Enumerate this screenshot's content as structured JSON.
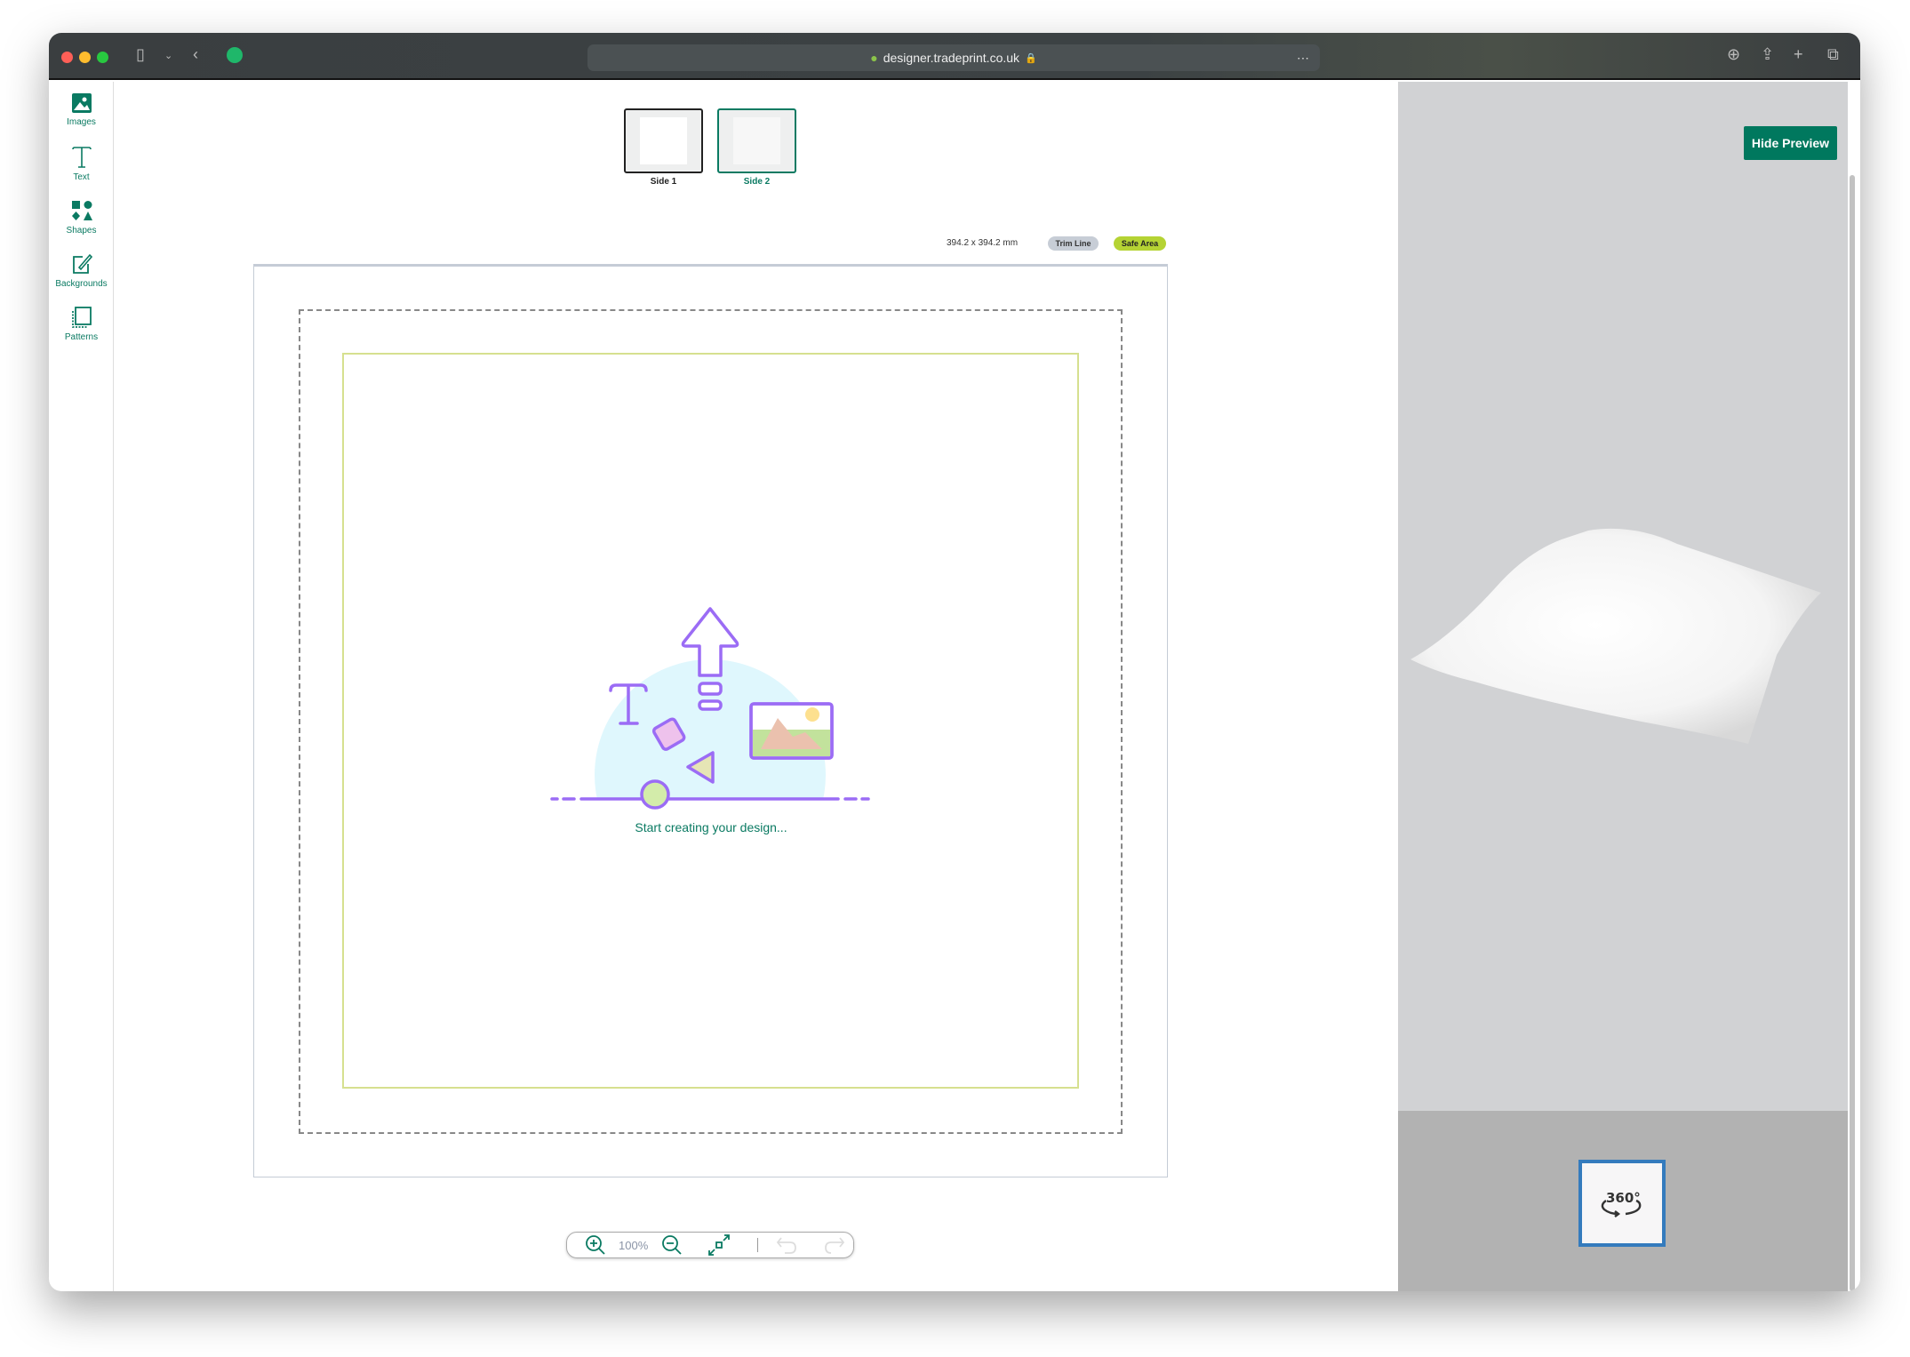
{
  "browser": {
    "url": "designer.tradeprint.co.uk"
  },
  "sidebar": {
    "items": [
      {
        "label": "Images",
        "icon": "image-icon"
      },
      {
        "label": "Text",
        "icon": "text-icon"
      },
      {
        "label": "Shapes",
        "icon": "shapes-icon"
      },
      {
        "label": "Backgrounds",
        "icon": "paint-brush-icon"
      },
      {
        "label": "Patterns",
        "icon": "patterns-icon"
      }
    ]
  },
  "sides": [
    {
      "label": "Side 1",
      "selected": true
    },
    {
      "label": "Side 2",
      "selected": false
    }
  ],
  "canvas": {
    "dimensions": "394.2 x 394.2 mm",
    "trim_label": "Trim Line",
    "safe_label": "Safe Area",
    "empty_text": "Start creating your design..."
  },
  "zoom": {
    "level": "100%"
  },
  "preview": {
    "hide_label": "Hide Preview",
    "view360": "360°"
  },
  "colors": {
    "accent": "#00785e",
    "safe": "#b5d334",
    "trim": "#c7cdd6",
    "illustration": "#9b6cf5"
  }
}
